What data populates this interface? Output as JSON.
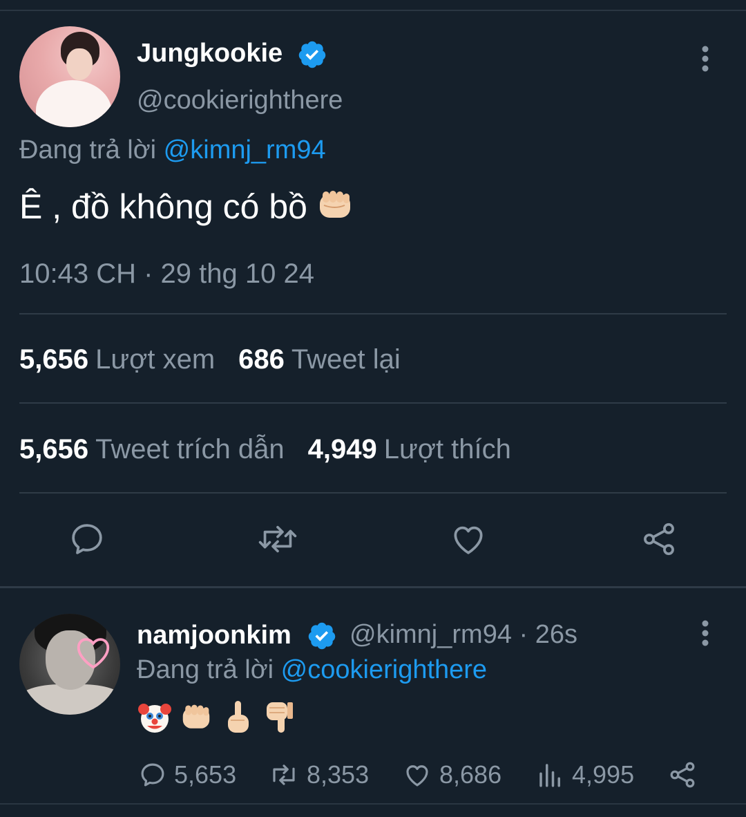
{
  "main_tweet": {
    "display_name": "Jungkookie",
    "handle": "@cookierighthere",
    "reply_prefix": "Đang trả lời",
    "reply_target": "@kimnj_rm94",
    "text": "Ê , đồ không có bồ",
    "timestamp": "10:43 CH · 29 thg 10 24",
    "stats": {
      "views_count": "5,656",
      "views_label": "Lượt xem",
      "retweets_count": "686",
      "retweets_label": "Tweet lại",
      "quotes_count": "5,656",
      "quotes_label": "Tweet trích dẫn",
      "likes_count": "4,949",
      "likes_label": "Lượt thích"
    },
    "actions": [
      "reply-icon",
      "retweet-icon",
      "like-icon",
      "share-icon"
    ]
  },
  "reply_tweet": {
    "display_name": "namjoonkim",
    "handle_time": "@kimnj_rm94 · 26s",
    "reply_prefix": "Đang trả lời",
    "reply_target": "@cookierighthere",
    "emojis": [
      "clown-face-emoji",
      "fist-emoji",
      "middle-finger-emoji",
      "thumbs-down-emoji"
    ],
    "counts": {
      "replies": "5,653",
      "retweets": "8,353",
      "likes": "8,686",
      "views": "4,995"
    }
  },
  "colors": {
    "background": "#15202b",
    "accent": "#1d9bf0",
    "secondary_text": "#8b98a5",
    "divider": "#2f3b47"
  }
}
